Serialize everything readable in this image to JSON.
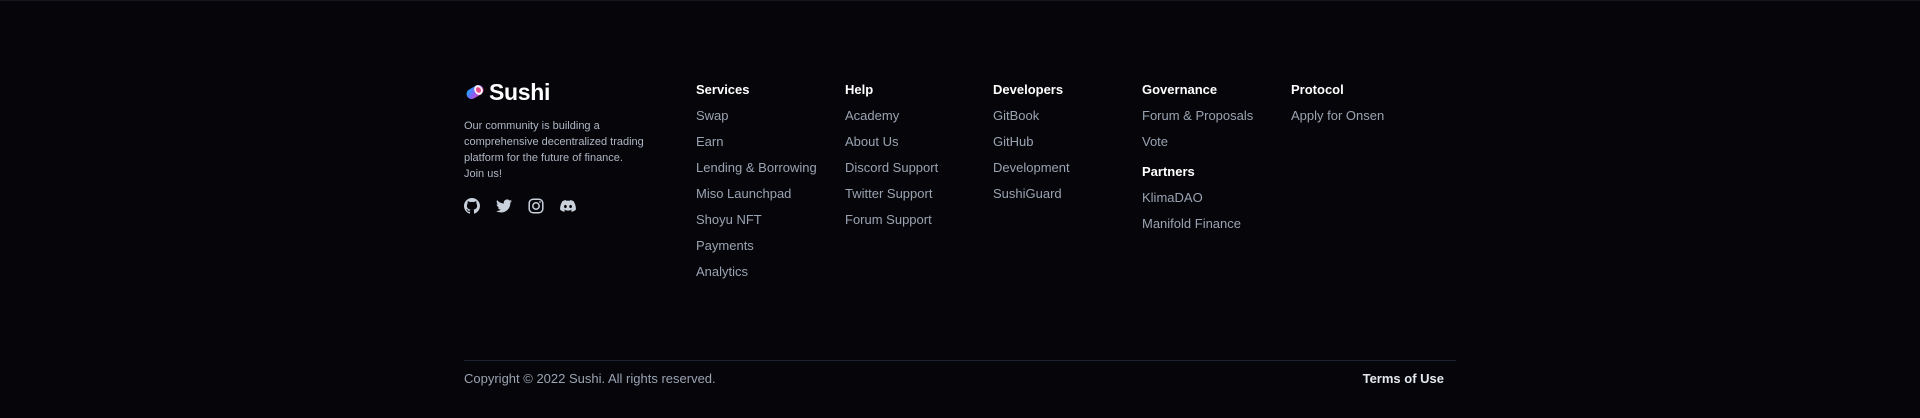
{
  "brand": {
    "name": "Sushi",
    "description": "Our community is building a comprehensive decentralized trading platform for the future of finance. Join us!",
    "socials": [
      {
        "icon": "github-icon"
      },
      {
        "icon": "twitter-icon"
      },
      {
        "icon": "instagram-icon"
      },
      {
        "icon": "discord-icon"
      }
    ]
  },
  "columns": {
    "services": {
      "title": "Services",
      "items": [
        "Swap",
        "Earn",
        "Lending & Borrowing",
        "Miso Launchpad",
        "Shoyu NFT",
        "Payments",
        "Analytics"
      ]
    },
    "help": {
      "title": "Help",
      "items": [
        "Academy",
        "About Us",
        "Discord Support",
        "Twitter Support",
        "Forum Support"
      ]
    },
    "developers": {
      "title": "Developers",
      "items": [
        "GitBook",
        "GitHub",
        "Development",
        "SushiGuard"
      ]
    },
    "governance": {
      "title": "Governance",
      "items": [
        "Forum & Proposals",
        "Vote"
      ]
    },
    "partners": {
      "title": "Partners",
      "items": [
        "KlimaDAO",
        "Manifold Finance"
      ]
    },
    "protocol": {
      "title": "Protocol",
      "items": [
        "Apply for Onsen"
      ]
    }
  },
  "bottom": {
    "copyright": "Copyright © 2022 Sushi. All rights reserved.",
    "terms": "Terms of Use"
  },
  "colors": {
    "background": "#06060a",
    "heading": "#ffffff",
    "link": "#9aa3b2",
    "divider": "#1c2233"
  }
}
